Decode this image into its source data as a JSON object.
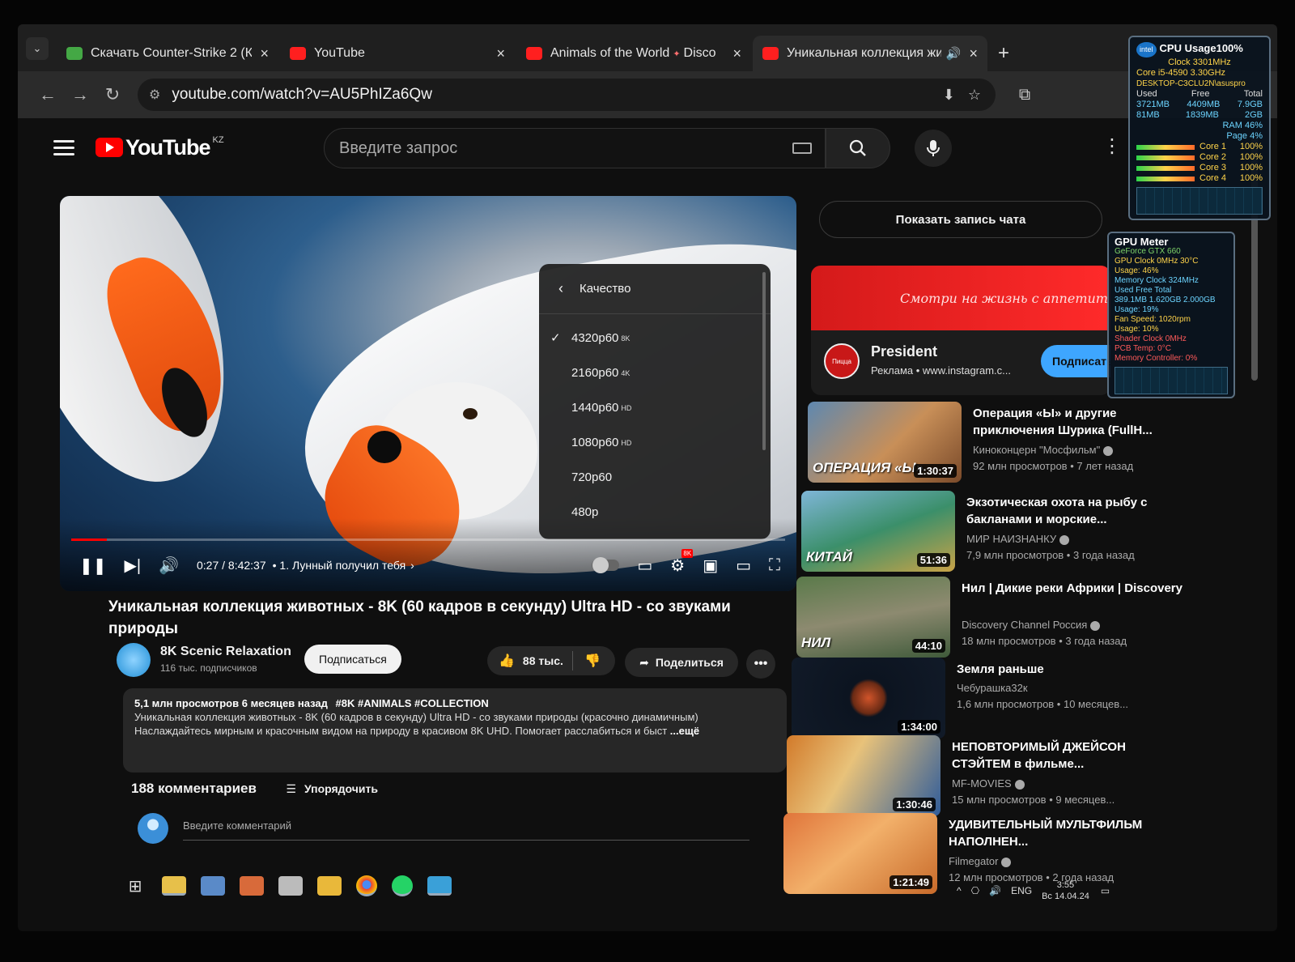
{
  "tabs": [
    {
      "label": "Скачать Counter-Strike 2 (Конт",
      "favicon": "counter-strike-icon"
    },
    {
      "label": "YouTube",
      "favicon": "youtube-icon"
    },
    {
      "label": "Animals of the World",
      "extra": "Disco",
      "favicon": "youtube-icon"
    },
    {
      "label": "Уникальная коллекция жи",
      "favicon": "youtube-icon",
      "active": true
    }
  ],
  "toolbar": {
    "url": "youtube.com/watch?v=AU5PhIZa6Qw"
  },
  "header": {
    "logo": "YouTube",
    "country": "KZ",
    "search_placeholder": "Введите запрос"
  },
  "player": {
    "time": "0:27 / 8:42:37",
    "chapter": "• 1. Лунный получил тебя",
    "badge": "8K",
    "progress": 0.05,
    "quality_menu": {
      "title": "Качество",
      "options": [
        {
          "label": "4320p60",
          "tag": "8K",
          "selected": true
        },
        {
          "label": "2160p60",
          "tag": "4K"
        },
        {
          "label": "1440p60",
          "tag": "HD"
        },
        {
          "label": "1080p60",
          "tag": "HD"
        },
        {
          "label": "720p60",
          "tag": ""
        },
        {
          "label": "480p",
          "tag": ""
        }
      ]
    }
  },
  "video": {
    "title": "Уникальная коллекция животных - 8K (60 кадров в секунду) Ultra HD - со звуками природы",
    "channel": "8K Scenic Relaxation",
    "subscribers": "116 тыс. подписчиков",
    "subscribe_label": "Подписаться",
    "likes": "88 тыс.",
    "share_label": "Поделиться",
    "more_label": "•••",
    "desc_stats": "5,1 млн просмотров  6 месяцев назад",
    "desc_tags": "#8K #ANIMALS #COLLECTION",
    "desc_line1": "Уникальная коллекция животных - 8K (60 кадров в секунду) Ultra HD - со звуками природы (красочно динамичным)",
    "desc_line2": "Наслаждайтесь мирным и красочным видом на природу в красивом 8K UHD. Помогает расслабиться и быст",
    "desc_more": " ...ещё"
  },
  "comments": {
    "count": "188 комментариев",
    "sort_label": "Упорядочить",
    "placeholder": "Введите комментарий"
  },
  "sidebar": {
    "chat_label": "Показать запись чата",
    "ad": {
      "banner": "Смотри на жизнь с аппетит",
      "logo": "Пицца",
      "name": "President",
      "meta": "Реклама • www.instagram.c...",
      "button": "Подписаться"
    },
    "recommendations": [
      {
        "title": "Операция «Ы» и другие приключения Шурика (FullH...",
        "channel": "Киноконцерн \"Мосфильм\"",
        "meta": "92 млн просмотров  • 7 лет назад",
        "duration": "1:30:37",
        "thumb_text": "ОПЕРАЦИЯ «Ы»"
      },
      {
        "title": "Экзотическая охота на рыбу с бакланами и морские...",
        "channel": "МИР НАИЗНАНКУ",
        "meta": "7,9 млн просмотров  • 3 года назад",
        "duration": "51:36",
        "thumb_text": "КИТАЙ"
      },
      {
        "title": "Нил | Дикие реки Африки | Discovery",
        "channel": "Discovery Channel Россия",
        "meta": "18 млн просмотров  • 3 года назад",
        "duration": "44:10",
        "thumb_text": "НИЛ"
      },
      {
        "title": "Земля раньше",
        "channel": "Чебурашка32к",
        "meta": "1,6 млн просмотров  • 10 месяцев...",
        "duration": "1:34:00",
        "thumb_text": ""
      },
      {
        "title": "НЕПОВТОРИМЫЙ ДЖЕЙСОН СТЭЙТЕМ в фильме...",
        "channel": "MF-MOVIES",
        "meta": "15 млн просмотров  • 9 месяцев...",
        "duration": "1:30:46",
        "thumb_text": ""
      },
      {
        "title": "УДИВИТЕЛЬНЫЙ МУЛЬТФИЛЬМ НАПОЛНЕН...",
        "channel": "Filmegator",
        "meta": "12 млн просмотров  • 2 года назад",
        "duration": "1:21:49",
        "thumb_text": ""
      }
    ]
  },
  "cpu_widget": {
    "title": "CPU Usage100%",
    "clock": "Clock 3301MHz",
    "model": "Core i5-4590 3.30GHz",
    "host": "DESKTOP-C3CLU2N\\asuspro",
    "hdr": [
      "Used",
      "Free",
      "Total"
    ],
    "row1": [
      "3721MB",
      "4409MB",
      "7.9GB"
    ],
    "row2": [
      "81MB",
      "1839MB",
      "2GB"
    ],
    "ram": "RAM   46%",
    "page": "Page   4%",
    "cores": [
      {
        "label": "Core 1",
        "pct": "100%"
      },
      {
        "label": "Core 2",
        "pct": "100%"
      },
      {
        "label": "Core 3",
        "pct": "100%"
      },
      {
        "label": "Core 4",
        "pct": "100%"
      }
    ]
  },
  "gpu_widget": {
    "title": "GPU Meter",
    "model": "GeForce GTX 660",
    "clock": "GPU Clock 0MHz      30°C",
    "usage": "Usage: 46%",
    "mem_clock": "Memory Clock 324MHz",
    "mem_hdr": "Used     Free     Total",
    "mem_vals": "389.1MB  1.620GB  2.000GB",
    "mem_usage": "Usage: 19%",
    "fan": "Fan Speed: 1020rpm",
    "fan_usage": "Usage: 10%",
    "shader": "Shader Clock 0MHz",
    "pcb": "PCB Temp: 0°C",
    "mem_ctrl": "Memory Controller: 0%"
  },
  "tray": {
    "lang": "ENG",
    "time": "3:55",
    "date": "Вс 14.04.24"
  }
}
